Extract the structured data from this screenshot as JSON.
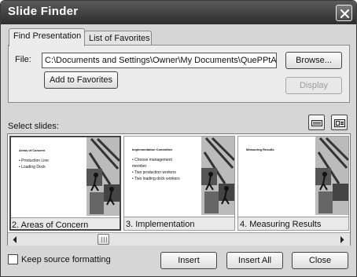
{
  "window": {
    "title": "Slide Finder"
  },
  "tabs": [
    {
      "label": "Find Presentation",
      "active": true
    },
    {
      "label": "List of Favorites",
      "active": false
    }
  ],
  "file": {
    "label": "File:",
    "value": "C:\\Documents and Settings\\Owner\\My Documents\\QuePPtAB"
  },
  "buttons": {
    "browse": "Browse...",
    "add_to_favorites": "Add to Favorites",
    "display": "Display",
    "insert": "Insert",
    "insert_all": "Insert All",
    "close": "Close"
  },
  "select_slides_label": "Select slides:",
  "slides": [
    {
      "caption": "2. Areas of Concern",
      "thumb_title": "Areas of Concern",
      "thumb_bullets": [
        "Production Line",
        "Loading Dock"
      ],
      "selected": true
    },
    {
      "caption": "3. Implementation",
      "thumb_title": "Implementation Committee",
      "thumb_bullets": [
        "Choose management member",
        "Two production workers",
        "Two loading dock workers"
      ],
      "selected": false
    },
    {
      "caption": "4. Measuring Results",
      "thumb_title": "Measuring Results",
      "thumb_bullets": [],
      "selected": false
    }
  ],
  "keep_source_formatting": {
    "label": "Keep source formatting",
    "checked": false
  },
  "icons": {
    "close": "close-icon",
    "list_view": "list-view-icon",
    "slide_view": "slide-view-icon",
    "scroll_left": "scroll-left-arrow-icon",
    "scroll_right": "scroll-right-arrow-icon"
  }
}
